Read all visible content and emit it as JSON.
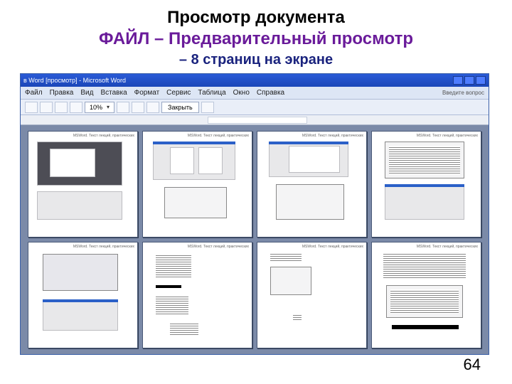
{
  "heading": {
    "line1": "Просмотр документа",
    "line2": "ФАЙЛ – Предварительный просмотр",
    "line3": "– 8 страниц на экране"
  },
  "window": {
    "title": "в Word [просмотр] - Microsoft Word",
    "menubar": [
      "Файл",
      "Правка",
      "Вид",
      "Вставка",
      "Формат",
      "Сервис",
      "Таблица",
      "Окно",
      "Справка"
    ],
    "menubar_right": "Введите вопрос",
    "zoom": "10%",
    "close_btn": "Закрыть"
  },
  "page_header": "MSWord. Текст лекций, практических",
  "slide_number": "64"
}
